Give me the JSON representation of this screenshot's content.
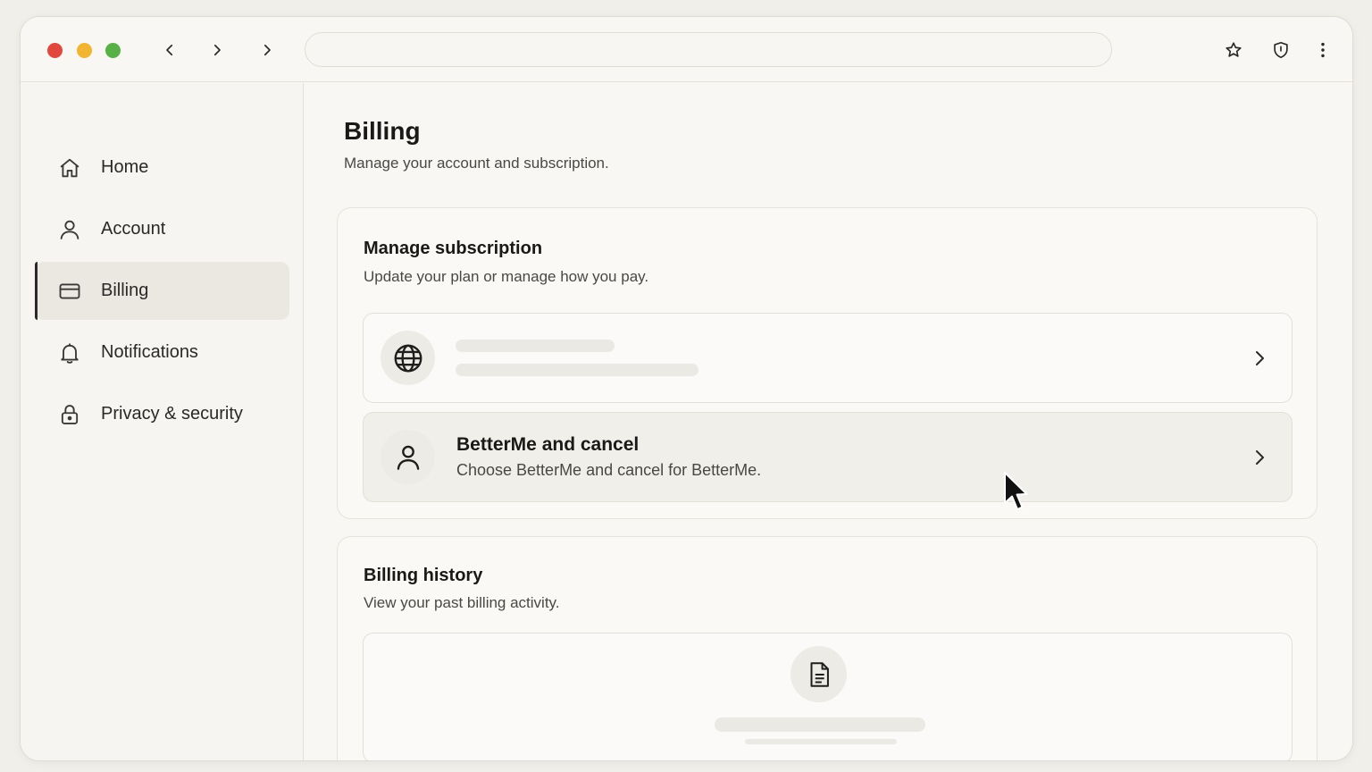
{
  "browser": {
    "url": "",
    "icons": [
      "back-icon",
      "forward-icon",
      "forward-icon",
      "star-icon",
      "shield-icon",
      "more-vertical-icon"
    ]
  },
  "sidebar": {
    "items": [
      {
        "label": "Home",
        "icon": "home-icon",
        "active": false
      },
      {
        "label": "Account",
        "icon": "user-icon",
        "active": false
      },
      {
        "label": "Billing",
        "icon": "credit-card-icon",
        "active": true
      },
      {
        "label": "Notifications",
        "icon": "bell-icon",
        "active": false
      },
      {
        "label": "Privacy & security",
        "icon": "lock-icon",
        "active": false
      }
    ]
  },
  "main": {
    "title": "Billing",
    "subtitle": "Manage your account and subscription."
  },
  "subscription_card": {
    "title": "Manage subscription",
    "subtitle": "Update your plan or manage how you pay.",
    "rows": [
      {
        "icon": "globe-icon",
        "title": "",
        "subtitle": "",
        "loading": true
      },
      {
        "icon": "user-icon",
        "title": "BetterMe and cancel",
        "subtitle": "Choose BetterMe and cancel for BetterMe.",
        "loading": false
      }
    ]
  },
  "history_card": {
    "title": "Billing history",
    "subtitle": "View your past billing activity.",
    "icon": "document-icon"
  },
  "colors": {
    "background": "#f1efea",
    "window": "#f8f7f4",
    "close": "#e2473d",
    "minimize": "#f2b531",
    "maximize": "#57b146",
    "active_nav": "#ebe8e2"
  }
}
